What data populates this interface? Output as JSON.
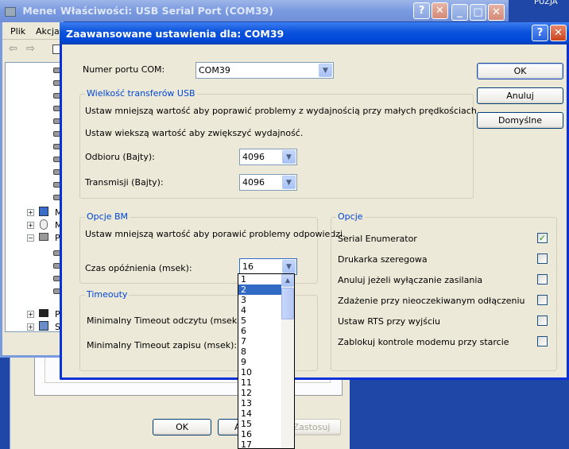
{
  "devmgr": {
    "title": "Menedż",
    "menu": [
      "Plik",
      "Akcja"
    ],
    "tree": [
      "M",
      "M",
      "Po",
      "Pr",
      "SI"
    ]
  },
  "props": {
    "title": "Właściwości: USB Serial Port (COM39)",
    "ok": "OK",
    "apply": "Zastosuj",
    "cancel_partial": "A"
  },
  "desktop": {
    "corner_text": "PUZJA"
  },
  "adv": {
    "title": "Zaawansowane ustawienia dla: COM39",
    "port_label": "Numer portu COM:",
    "port_value": "COM39",
    "usb_group": "Wielkość transferów USB",
    "usb_hint1": "Ustaw mniejszą wartość aby poprawić problemy z wydajnością przy małych prędkościach.",
    "usb_hint2": "Ustaw wiekszą wartość aby zwiększyć wydajność.",
    "rx_label": "Odbioru (Bajty):",
    "rx_value": "4096",
    "tx_label": "Transmisji (Bajty):",
    "tx_value": "4096",
    "bm_group": "Opcje BM",
    "bm_hint": "Ustaw mniejszą wartość aby porawić problemy odpowiedzi.",
    "latency_label": "Czas opóźnienia (msek):",
    "latency_value": "16",
    "timeouts_group": "Timeouty",
    "read_timeout_label": "Minimalny Timeout odczytu (msek):",
    "write_timeout_label": "Minimalny Timeout zapisu (msek):",
    "options_group": "Opcje",
    "options": [
      {
        "label": "Serial Enumerator",
        "checked": true
      },
      {
        "label": "Drukarka szeregowa",
        "checked": false
      },
      {
        "label": "Anuluj jeżeli wyłączanie zasilania",
        "checked": false
      },
      {
        "label": "Zdażenie przy nieoczekiwanym odłączeniu",
        "checked": false
      },
      {
        "label": "Ustaw RTS przy wyjściu",
        "checked": false
      },
      {
        "label": "Zablokuj kontrole modemu przy starcie",
        "checked": false
      }
    ],
    "ok": "OK",
    "cancel": "Anuluj",
    "defaults": "Domyślne"
  },
  "dropdown": {
    "items": [
      "1",
      "2",
      "3",
      "4",
      "5",
      "6",
      "7",
      "8",
      "9",
      "10",
      "11",
      "12",
      "13",
      "14",
      "15",
      "16",
      "17"
    ],
    "selected_index": 1
  },
  "colors": {
    "accent": "#0046d5",
    "selection": "#316ac5",
    "dialog_bg": "#ece9d8"
  }
}
